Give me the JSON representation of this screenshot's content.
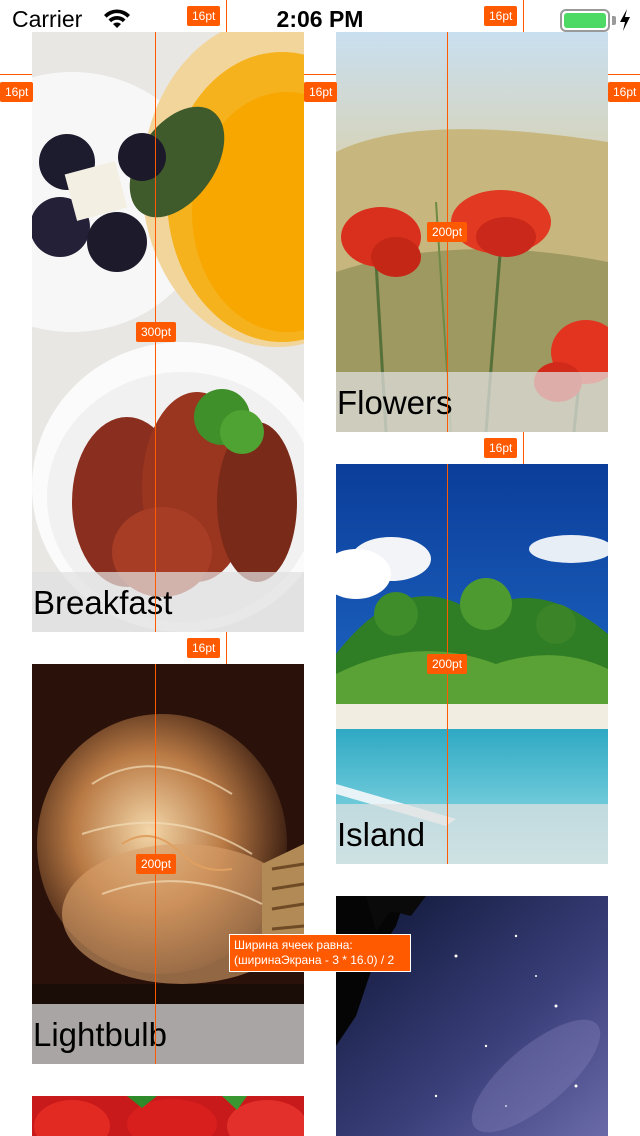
{
  "status_bar": {
    "carrier": "Carrier",
    "time": "2:06 PM",
    "battery_level": 1.0,
    "battery_color": "#4cd964",
    "icons": [
      "wifi-icon",
      "battery-icon",
      "charging-bolt-icon"
    ]
  },
  "cells": [
    {
      "caption": "Breakfast",
      "image": "breakfast-photo",
      "height_label": "300pt"
    },
    {
      "caption": "Flowers",
      "image": "poppies-photo",
      "height_label": "200pt"
    },
    {
      "caption": "Island",
      "image": "island-photo",
      "height_label": "200pt"
    },
    {
      "caption": "Lightbulb",
      "image": "lightbulb-photo",
      "height_label": "200pt"
    },
    {
      "caption": "",
      "image": "strawberries-photo"
    },
    {
      "caption": "",
      "image": "night-sky-photo"
    }
  ],
  "annotations": {
    "spacing_label": "16pt",
    "note": "Ширина ячеек равна: (ширинаЭкрана - 3 * 16.0) / 2",
    "accent_color": "#ff5a00"
  }
}
